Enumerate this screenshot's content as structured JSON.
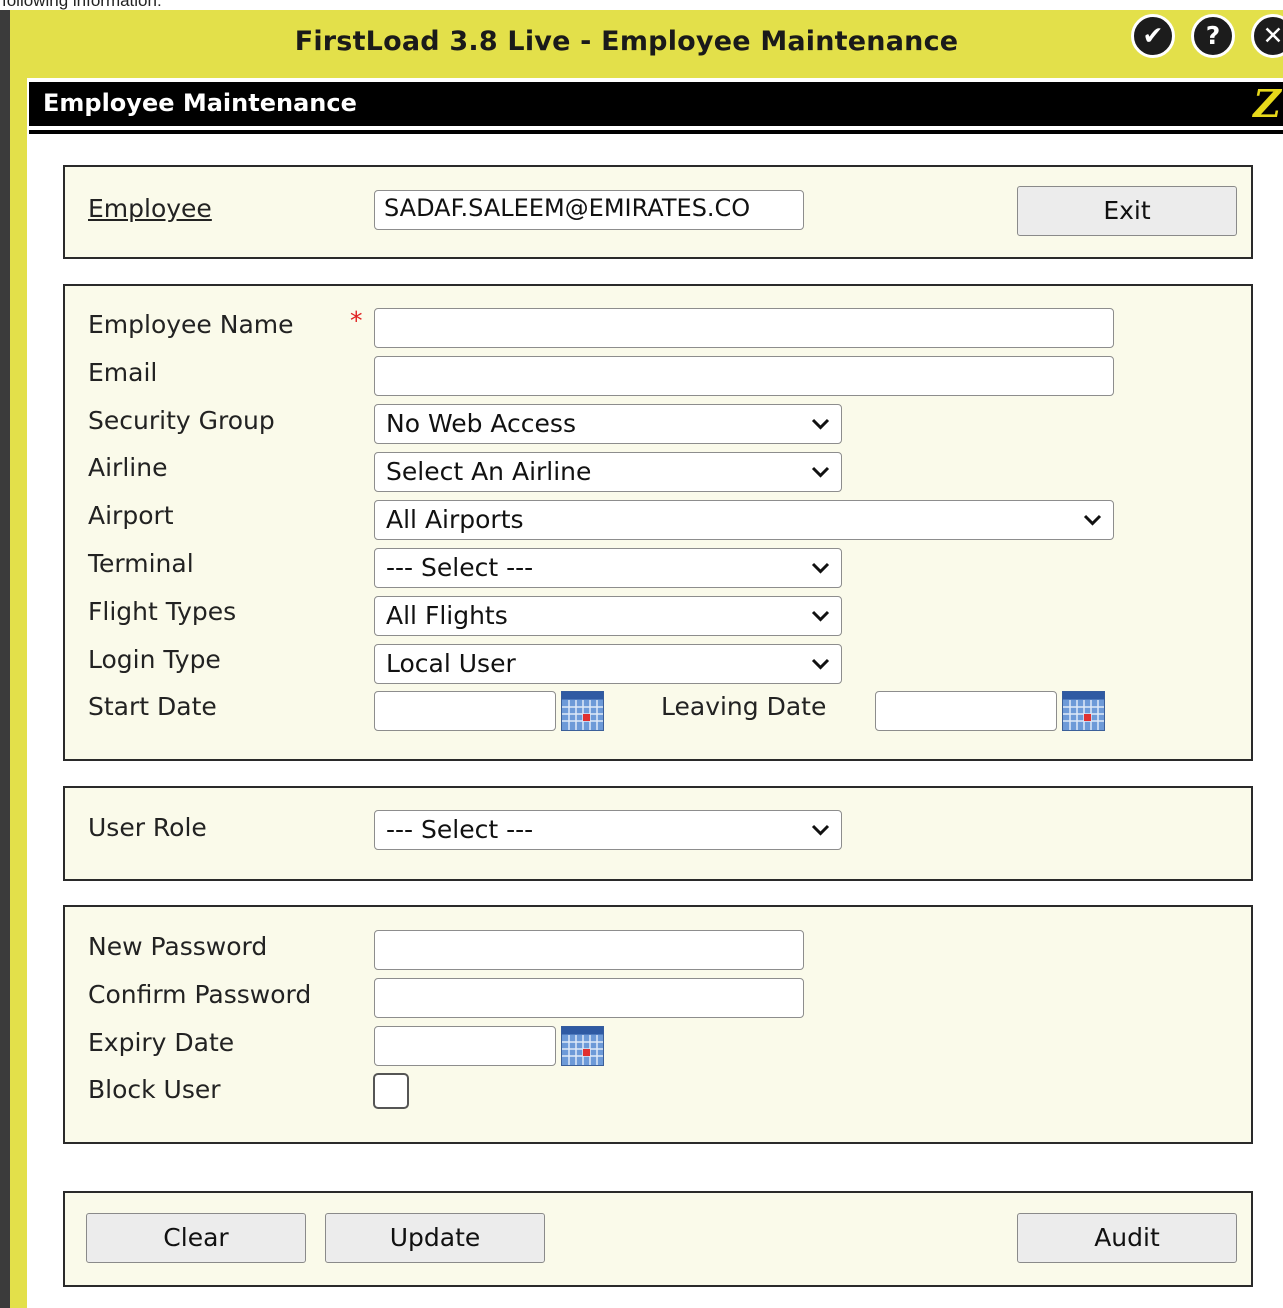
{
  "top_strip_text": "following information:",
  "window": {
    "title": "FirstLoad 3.8 Live - Employee Maintenance",
    "buttons": {
      "ok": "✔",
      "help": "?",
      "close": "✕"
    }
  },
  "header": {
    "title": "Employee Maintenance",
    "logo": "Z"
  },
  "employee_panel": {
    "label": "Employee",
    "value": "SADAF.SALEEM@EMIRATES.CO",
    "exit_label": "Exit"
  },
  "details": {
    "employee_name_label": "Employee Name",
    "required_marker": "*",
    "employee_name_value": "",
    "email_label": "Email",
    "email_value": "",
    "security_group_label": "Security Group",
    "security_group_value": "No Web Access",
    "airline_label": "Airline",
    "airline_value": "Select An Airline",
    "airport_label": "Airport",
    "airport_value": "All Airports",
    "terminal_label": "Terminal",
    "terminal_value": "--- Select ---",
    "flight_types_label": "Flight Types",
    "flight_types_value": "All Flights",
    "login_type_label": "Login Type",
    "login_type_value": "Local User",
    "start_date_label": "Start Date",
    "start_date_value": "",
    "leaving_date_label": "Leaving Date",
    "leaving_date_value": ""
  },
  "role": {
    "user_role_label": "User Role",
    "user_role_value": "--- Select ---"
  },
  "password": {
    "new_password_label": "New Password",
    "confirm_password_label": "Confirm Password",
    "expiry_date_label": "Expiry Date",
    "block_user_label": "Block User"
  },
  "actions": {
    "clear_label": "Clear",
    "update_label": "Update",
    "audit_label": "Audit"
  },
  "colors": {
    "window_frame": "#e3e04a",
    "panel_background": "#fafaea",
    "header_bar": "#000000",
    "logo": "#e6d81a",
    "required": "#e02020"
  },
  "icons": {
    "dropdown": "chevron-down-icon",
    "calendar": "calendar-icon",
    "title_ok": "check-circle-icon",
    "title_help": "help-circle-icon",
    "title_close": "close-circle-icon"
  }
}
